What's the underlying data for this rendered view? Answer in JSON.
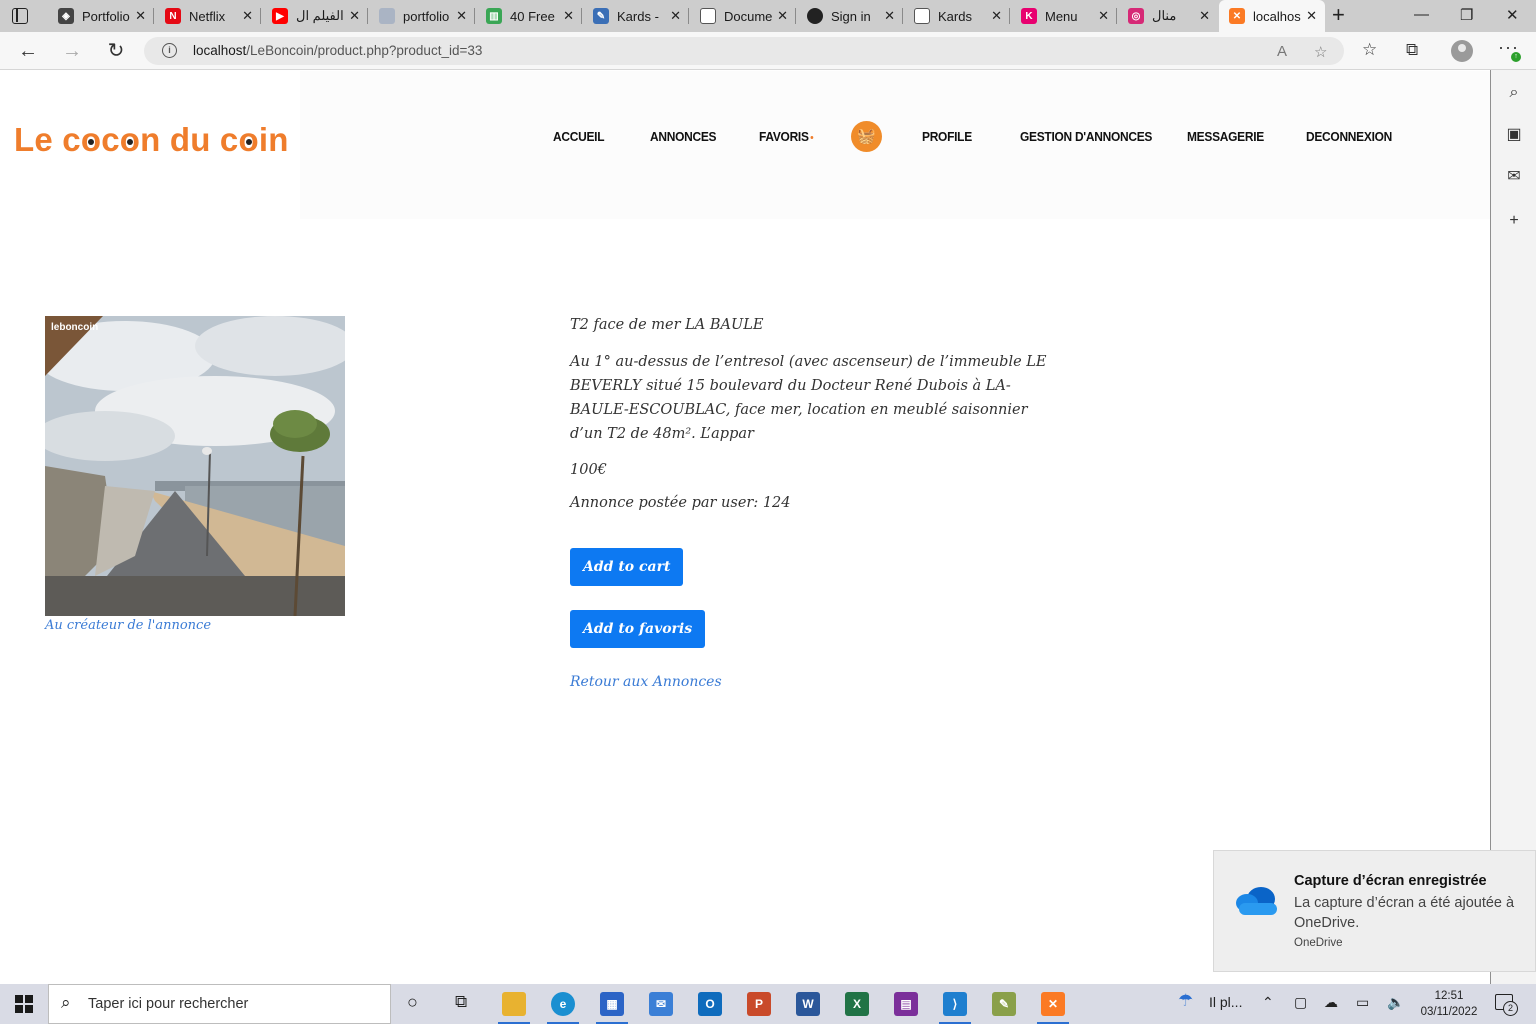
{
  "browser": {
    "tabs": [
      {
        "title": "Portfolio",
        "icon": "codepen-icon",
        "color": "#444444"
      },
      {
        "title": "Netflix",
        "icon": "netflix-icon",
        "color": "#e50914"
      },
      {
        "title": "الفيلم ال",
        "icon": "youtube-icon",
        "color": "#ff0000"
      },
      {
        "title": "portfolio",
        "icon": "github-alt-icon",
        "color": "#aab4c4"
      },
      {
        "title": "40 Free",
        "icon": "bars-icon",
        "color": "#3aa655"
      },
      {
        "title": "Kards -",
        "icon": "feather-icon",
        "color": "#3b6fb6"
      },
      {
        "title": "Document",
        "icon": "document-icon",
        "color": "#555555"
      },
      {
        "title": "Sign in",
        "icon": "github-icon",
        "color": "#222222"
      },
      {
        "title": "Kards",
        "icon": "document-icon",
        "color": "#555555"
      },
      {
        "title": "Menu",
        "icon": "k-icon",
        "color": "#e8006f"
      },
      {
        "title": "منال",
        "icon": "instagram-icon",
        "color": "#d62976"
      },
      {
        "title": "localhost",
        "icon": "xampp-icon",
        "color": "#fb7a24"
      }
    ],
    "active_tab": 11,
    "url_host": "localhost",
    "url_path": "/LeBoncoin/product.php?product_id=33"
  },
  "site": {
    "logo_parts": [
      "Le c",
      "o",
      "c",
      "o",
      "n du c",
      "o",
      "in"
    ],
    "nav": [
      {
        "label": "ACCUEIL"
      },
      {
        "label": "ANNONCES"
      },
      {
        "label": "FAVORIS"
      },
      {
        "label": "PROFILE"
      },
      {
        "label": "GESTION D'ANNONCES"
      },
      {
        "label": "MESSAGERIE"
      },
      {
        "label": "DECONNEXION"
      }
    ],
    "accent": "#ef7d2c"
  },
  "product": {
    "image_tag": "leboncoin",
    "creator_link": "Au créateur de l'annonce",
    "title": "T2 face de mer LA BAULE",
    "description": "Au 1° au-dessus de l’entresol (avec ascenseur) de l’immeuble LE BEVERLY situé 15 boulevard du Docteur René Dubois à LA-BAULE-ESCOUBLAC, face mer, location en meublé saisonnier d’un T2 de 48m². L’appar",
    "price": "100€",
    "posted_by": "Annonce postée par user: 124",
    "add_to_cart": "Add to cart",
    "add_to_favoris": "Add to favoris",
    "back_link": "Retour aux Annonces",
    "button_color": "#0d79f2",
    "link_color": "#3a7bd5"
  },
  "toast": {
    "title": "Capture d’écran enregistrée",
    "body": "La capture d’écran a été ajoutée à OneDrive.",
    "source": "OneDrive"
  },
  "taskbar": {
    "search_placeholder": "Taper ici pour rechercher",
    "weather": "Il pl...",
    "time": "12:51",
    "date": "03/11/2022",
    "notification_count": "2"
  }
}
